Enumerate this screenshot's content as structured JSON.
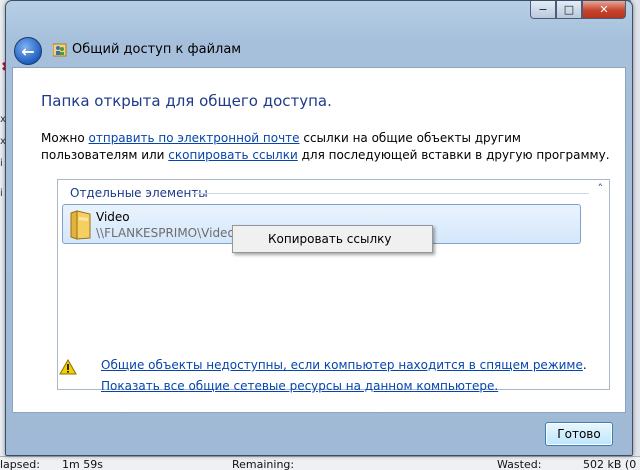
{
  "window": {
    "title": "Общий доступ к файлам",
    "min_glyph": "−",
    "max_glyph": "□",
    "close_glyph": "✕",
    "back_glyph": "←"
  },
  "content": {
    "heading": "Папка открыта для общего доступа.",
    "para_prefix": "Можно ",
    "link_email": "отправить по электронной почте",
    "para_middle": " ссылки на общие объекты другим пользователям или ",
    "link_copy": "скопировать ссылки",
    "para_suffix": " для последующей вставки в другую программу."
  },
  "panel": {
    "group_title": "Отдельные элементы",
    "collapse_glyph": "˄",
    "items": [
      {
        "name": "Video",
        "path": "\\\\FLANKESPRIMO\\Video"
      }
    ]
  },
  "context_menu": {
    "items": [
      "Копировать ссылку"
    ]
  },
  "footer": {
    "warning_link": "Общие объекты недоступны, если компьютер находится в спящем режиме",
    "warning_period": ".",
    "show_link": "Показать все общие сетевые ресурсы на данном компьютере.",
    "ok_label": "Готово"
  },
  "background_status": {
    "elapsed_label": "lapsed:",
    "elapsed_value": "1m 59s",
    "remaining_label": "Remaining:",
    "wasted_label": "Wasted:",
    "wasted_value": "502 kB (0"
  },
  "colors": {
    "heading": "#1e3a8a",
    "link": "#0645ad",
    "selection": "#d4e7fb",
    "warning": "#f5d000"
  }
}
